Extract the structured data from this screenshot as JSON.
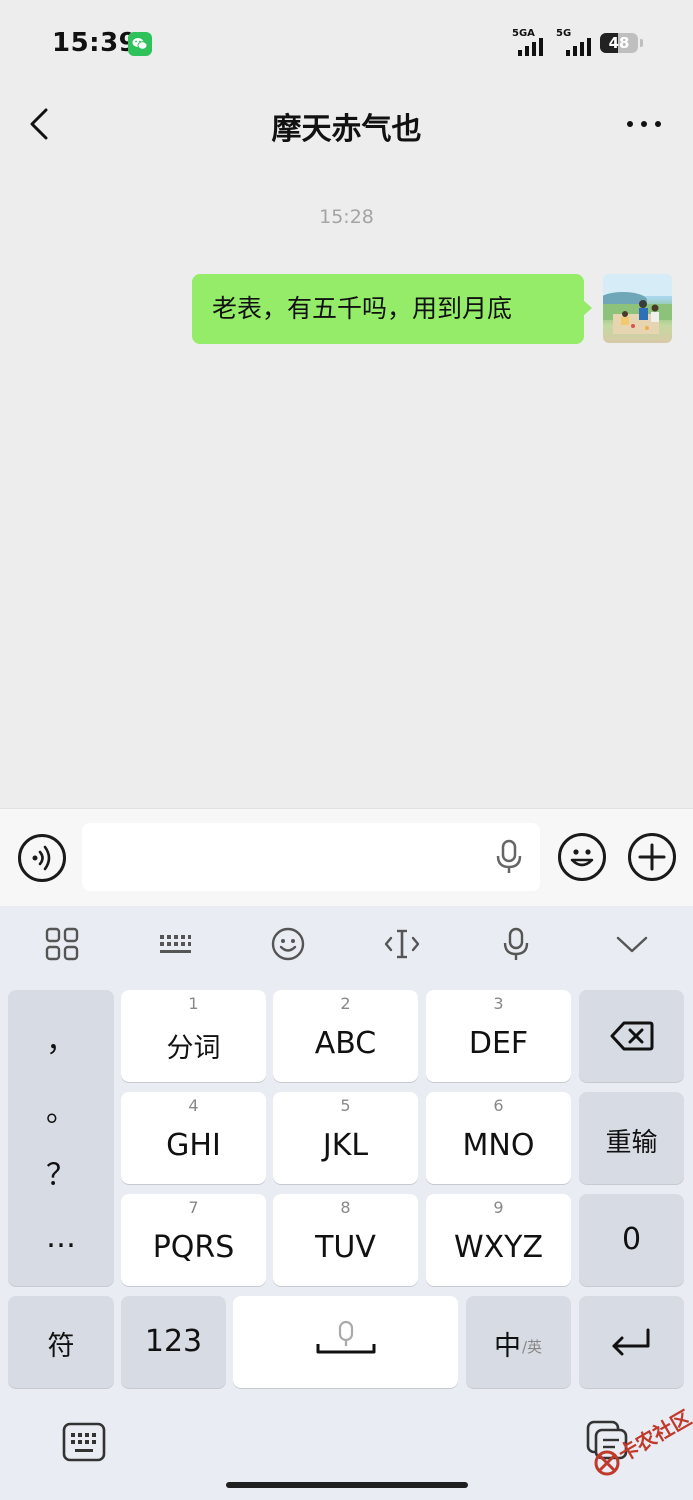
{
  "status_bar": {
    "time": "15:39",
    "signal_1_label": "5GA",
    "signal_2_label": "5G",
    "battery": "48",
    "battery_level": 0.48
  },
  "nav": {
    "title": "摩天赤气也"
  },
  "chat": {
    "timestamp": "15:28",
    "messages": [
      {
        "sender": "me",
        "text": "老表，有五千吗，用到月底"
      }
    ]
  },
  "input": {
    "value": "",
    "placeholder": ""
  },
  "keyboard": {
    "punctuation": [
      "，",
      "。",
      "？",
      "…"
    ],
    "keys": [
      {
        "num": "1",
        "label": "分词"
      },
      {
        "num": "2",
        "label": "ABC"
      },
      {
        "num": "3",
        "label": "DEF"
      },
      {
        "num": "4",
        "label": "GHI"
      },
      {
        "num": "5",
        "label": "JKL"
      },
      {
        "num": "6",
        "label": "MNO"
      },
      {
        "num": "7",
        "label": "PQRS"
      },
      {
        "num": "8",
        "label": "TUV"
      },
      {
        "num": "9",
        "label": "WXYZ"
      }
    ],
    "reinput": "重输",
    "zero": "0",
    "symbols": "符",
    "numbers": "123",
    "lang_main": "中",
    "lang_sub": "/英"
  },
  "watermark": "卡农社区",
  "colors": {
    "bubble_green": "#95ec69",
    "wechat_green": "#2fc25b",
    "chat_bg": "#ededed"
  }
}
